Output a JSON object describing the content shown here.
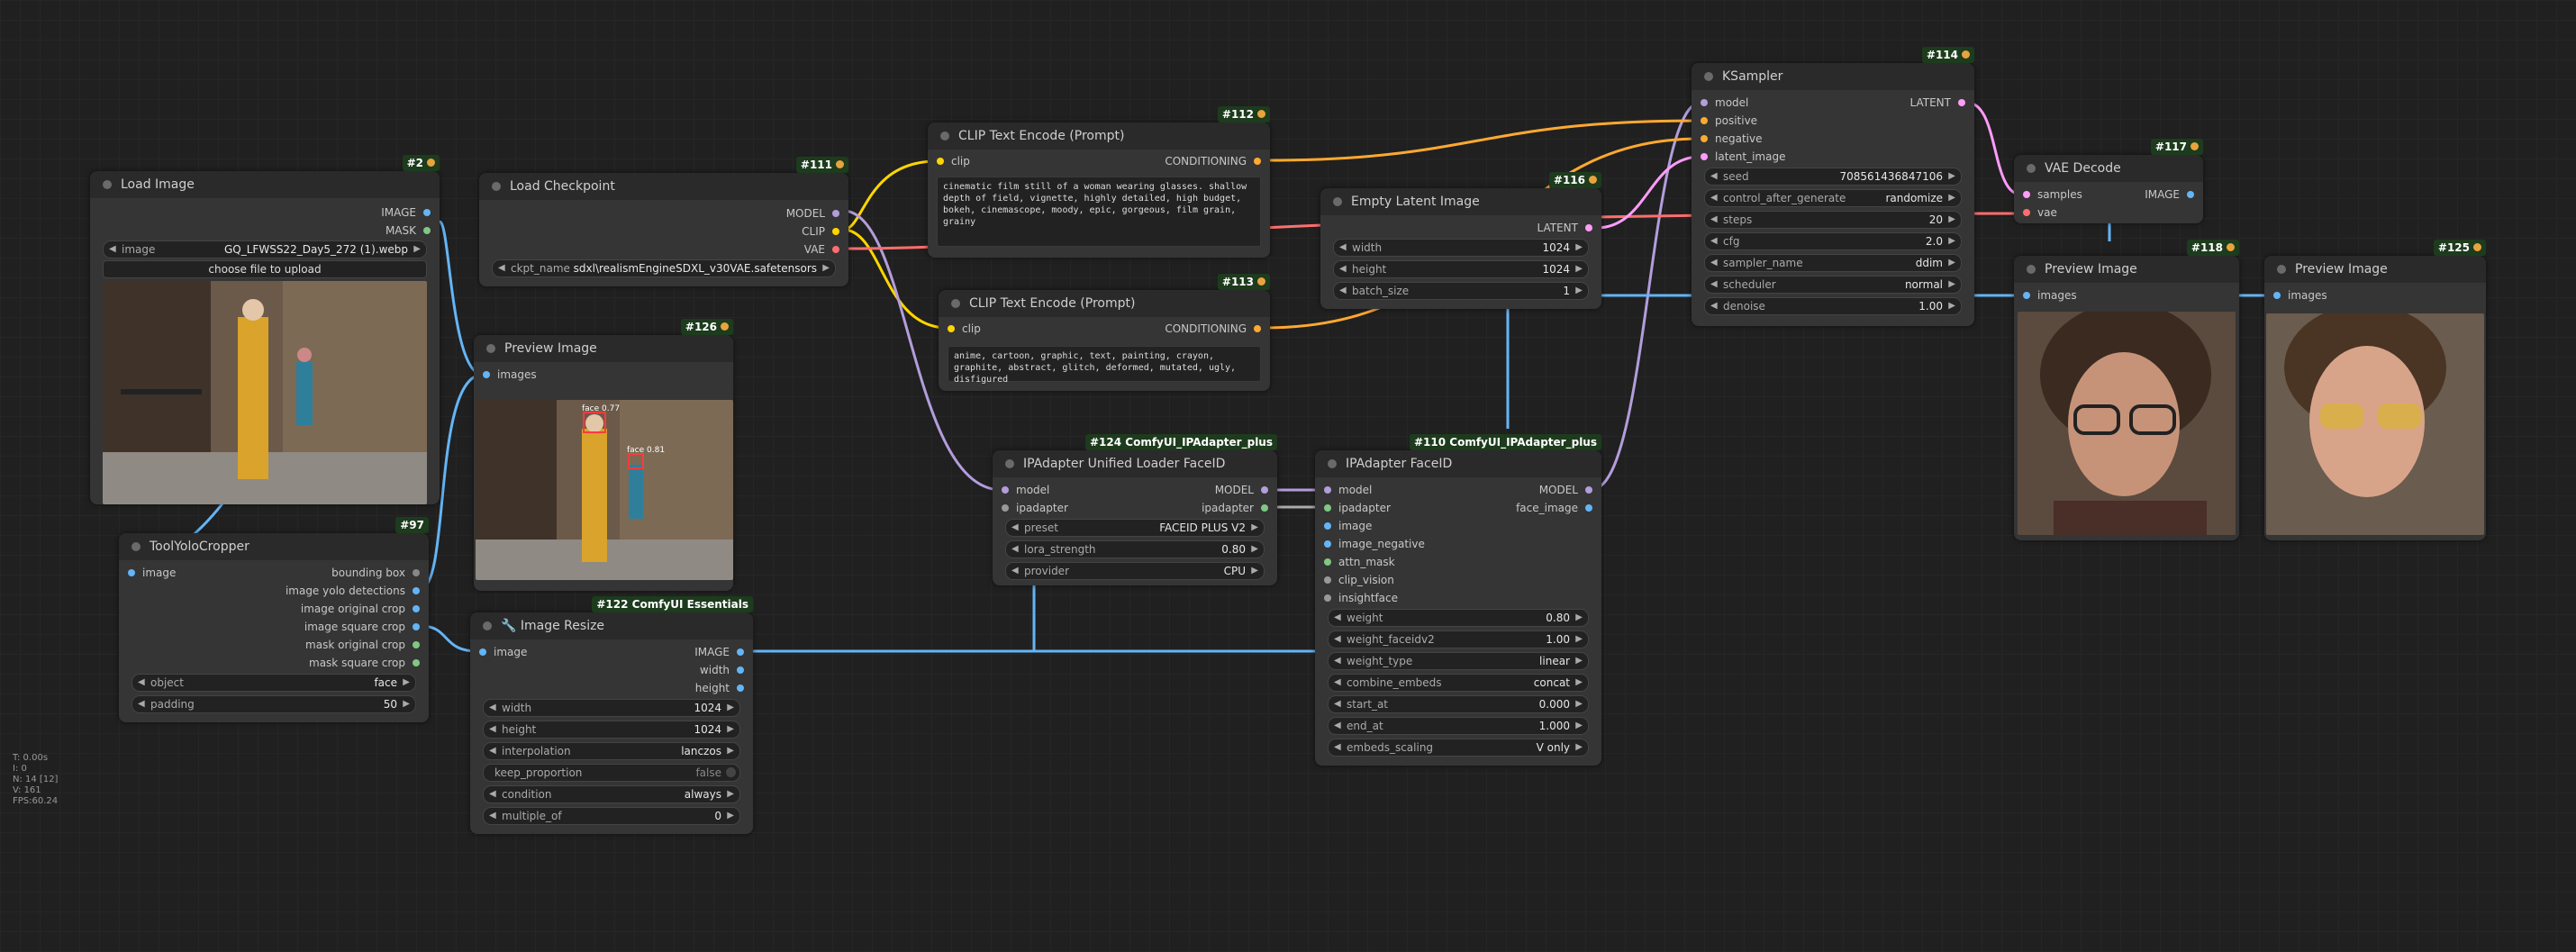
{
  "colors": {
    "clip": "#ffd500",
    "model": "#b39ddb",
    "vae": "#ff6e6e",
    "conditioning": "#ffa931",
    "latent": "#ff9cf9",
    "image": "#64b5f6",
    "mask": "#81c784",
    "ipadapter": "#999999"
  },
  "stats": [
    "T: 0.00s",
    "I: 0",
    "N: 14 [12]",
    "V: 161",
    "FPS:60.24"
  ],
  "load_image": {
    "title": "Load Image",
    "badge": "#2",
    "out_image": "IMAGE",
    "out_mask": "MASK",
    "image_label": "image",
    "image_value": "GQ_LFWSS22_Day5_272 (1).webp",
    "upload": "choose file to upload"
  },
  "load_checkpoint": {
    "title": "Load Checkpoint",
    "badge": "#111",
    "out_model": "MODEL",
    "out_clip": "CLIP",
    "out_vae": "VAE",
    "ckpt_label": "ckpt_name",
    "ckpt_value": "sdxl\\realismEngineSDXL_v30VAE.safetensors"
  },
  "clip_pos": {
    "title": "CLIP Text Encode (Prompt)",
    "badge": "#112",
    "in_clip": "clip",
    "out": "CONDITIONING",
    "text": "cinematic film still of a woman wearing glasses. shallow depth of field, vignette, highly detailed, high budget, bokeh, cinemascope, moody, epic, gorgeous, film grain, grainy"
  },
  "clip_neg": {
    "title": "CLIP Text Encode (Prompt)",
    "badge": "#113",
    "in_clip": "clip",
    "out": "CONDITIONING",
    "text": "anime, cartoon, graphic, text, painting, crayon, graphite, abstract, glitch, deformed, mutated, ugly, disfigured"
  },
  "empty_latent": {
    "title": "Empty Latent Image",
    "badge": "#116",
    "out": "LATENT",
    "w_label": "width",
    "w": "1024",
    "h_label": "height",
    "h": "1024",
    "b_label": "batch_size",
    "b": "1"
  },
  "ksampler": {
    "title": "KSampler",
    "badge": "#114",
    "in_model": "model",
    "in_pos": "positive",
    "in_neg": "negative",
    "in_latent": "latent_image",
    "out": "LATENT",
    "widgets": [
      {
        "l": "seed",
        "v": "708561436847106"
      },
      {
        "l": "control_after_generate",
        "v": "randomize"
      },
      {
        "l": "steps",
        "v": "20"
      },
      {
        "l": "cfg",
        "v": "2.0"
      },
      {
        "l": "sampler_name",
        "v": "ddim"
      },
      {
        "l": "scheduler",
        "v": "normal"
      },
      {
        "l": "denoise",
        "v": "1.00"
      }
    ]
  },
  "vae_decode": {
    "title": "VAE Decode",
    "badge": "#117",
    "in_samples": "samples",
    "in_vae": "vae",
    "out": "IMAGE"
  },
  "preview118": {
    "title": "Preview Image",
    "badge": "#118",
    "in": "images"
  },
  "preview125": {
    "title": "Preview Image",
    "badge": "#125",
    "in": "images"
  },
  "preview126": {
    "title": "Preview Image",
    "badge": "#126",
    "in": "images",
    "det1": "face 0.77",
    "det2": "face 0.81"
  },
  "yolo": {
    "title": "ToolYoloCropper",
    "badge": "#97",
    "in_image": "image",
    "outs": [
      "bounding box",
      "image yolo detections",
      "image original crop",
      "image square crop",
      "mask original crop",
      "mask square crop"
    ],
    "widgets": [
      {
        "l": "object",
        "v": "face"
      },
      {
        "l": "padding",
        "v": "50"
      }
    ]
  },
  "resize": {
    "title": "Image Resize",
    "badge": "#122 ComfyUI Essentials",
    "in_image": "image",
    "out_image": "IMAGE",
    "out_w": "width",
    "out_h": "height",
    "widgets": [
      {
        "l": "width",
        "v": "1024"
      },
      {
        "l": "height",
        "v": "1024"
      },
      {
        "l": "interpolation",
        "v": "lanczos"
      },
      {
        "l": "keep_proportion",
        "v": "false"
      },
      {
        "l": "condition",
        "v": "always"
      },
      {
        "l": "multiple_of",
        "v": "0"
      }
    ]
  },
  "ipa_loader": {
    "title": "IPAdapter Unified Loader FaceID",
    "badge": "#124 ComfyUI_IPAdapter_plus",
    "in_model": "model",
    "in_ipa": "ipadapter",
    "out_model": "MODEL",
    "out_ipa": "ipadapter",
    "widgets": [
      {
        "l": "preset",
        "v": "FACEID PLUS V2"
      },
      {
        "l": "lora_strength",
        "v": "0.80"
      },
      {
        "l": "provider",
        "v": "CPU"
      }
    ]
  },
  "ipa_faceid": {
    "title": "IPAdapter FaceID",
    "badge": "#110 ComfyUI_IPAdapter_plus",
    "ins": [
      "model",
      "ipadapter",
      "image",
      "image_negative",
      "attn_mask",
      "clip_vision",
      "insightface"
    ],
    "out_model": "MODEL",
    "out_face": "face_image",
    "widgets": [
      {
        "l": "weight",
        "v": "0.80"
      },
      {
        "l": "weight_faceidv2",
        "v": "1.00"
      },
      {
        "l": "weight_type",
        "v": "linear"
      },
      {
        "l": "combine_embeds",
        "v": "concat"
      },
      {
        "l": "start_at",
        "v": "0.000"
      },
      {
        "l": "end_at",
        "v": "1.000"
      },
      {
        "l": "embeds_scaling",
        "v": "V only"
      }
    ]
  }
}
